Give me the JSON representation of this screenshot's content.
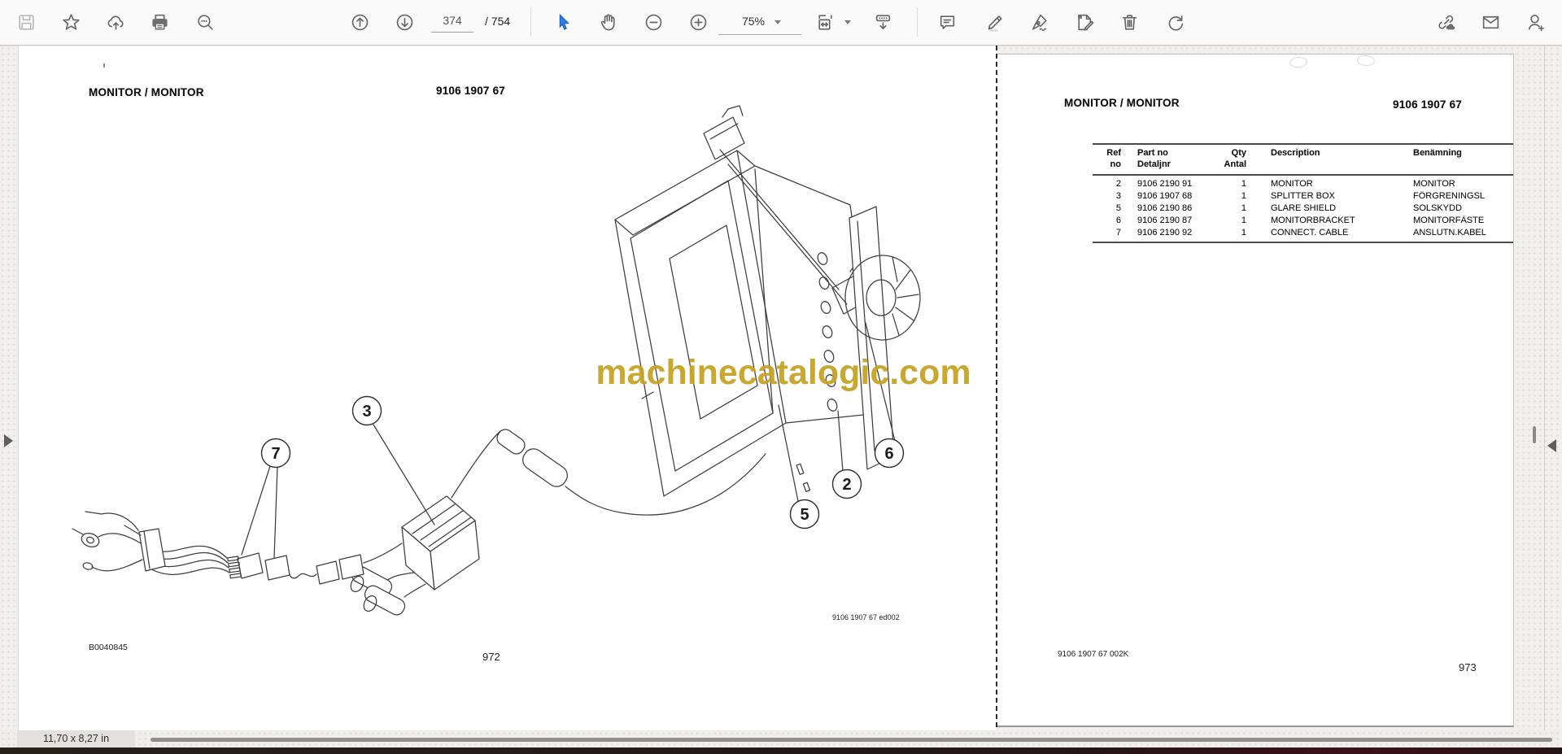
{
  "toolbar": {
    "page_current": "374",
    "page_total": "/ 754",
    "zoom_level": "75%",
    "icons": [
      "save",
      "bookmark",
      "share-upload",
      "print",
      "search",
      "page-up",
      "page-down",
      "select-tool",
      "hand-tool",
      "zoom-out",
      "zoom-in",
      "zoom-level",
      "fit-page",
      "continuous-scroll",
      "comment",
      "highlight",
      "signature",
      "edit-page",
      "delete",
      "rotate",
      "share-link",
      "email",
      "add-contact"
    ]
  },
  "left_page": {
    "title": "MONITOR / MONITOR",
    "doc_number": "9106 1907 67",
    "watermark": "machinecatalogic.com",
    "figure_code": "B0040845",
    "page_number": "972",
    "drawing_ref": "9106 1907 67 ed002",
    "callouts": [
      "3",
      "7",
      "5",
      "2",
      "6"
    ]
  },
  "right_page": {
    "title": "MONITOR / MONITOR",
    "doc_number": "9106 1907 67",
    "footer_ref": "9106 1907 67  002K",
    "page_number": "973",
    "table": {
      "headers": {
        "ref1": "Ref",
        "ref2": "no",
        "part1": "Part no",
        "part2": "Detaljnr",
        "qty1": "Qty",
        "qty2": "Antal",
        "desc": "Description",
        "ben": "Benämning"
      },
      "rows": [
        {
          "ref": "2",
          "part": "9106 2190 91",
          "qty": "1",
          "desc": "MONITOR",
          "ben": "MONITOR"
        },
        {
          "ref": "3",
          "part": "9106 1907 68",
          "qty": "1",
          "desc": "SPLITTER BOX",
          "ben": "FÖRGRENINGSL"
        },
        {
          "ref": "5",
          "part": "9106 2190 86",
          "qty": "1",
          "desc": "GLARE SHIELD",
          "ben": "SOLSKYDD"
        },
        {
          "ref": "6",
          "part": "9106 2190 87",
          "qty": "1",
          "desc": "MONITORBRACKET",
          "ben": "MONITORFÄSTE"
        },
        {
          "ref": "7",
          "part": "9106 2190 92",
          "qty": "1",
          "desc": "CONNECT. CABLE",
          "ben": "ANSLUTN.KABEL"
        }
      ]
    }
  },
  "status_bar": {
    "dimensions": "11,70 x 8,27 in"
  },
  "colors": {
    "accent_blue": "#2f7ce0",
    "watermark_gold": "#c5a120",
    "toolbar_icon": "#676767"
  }
}
